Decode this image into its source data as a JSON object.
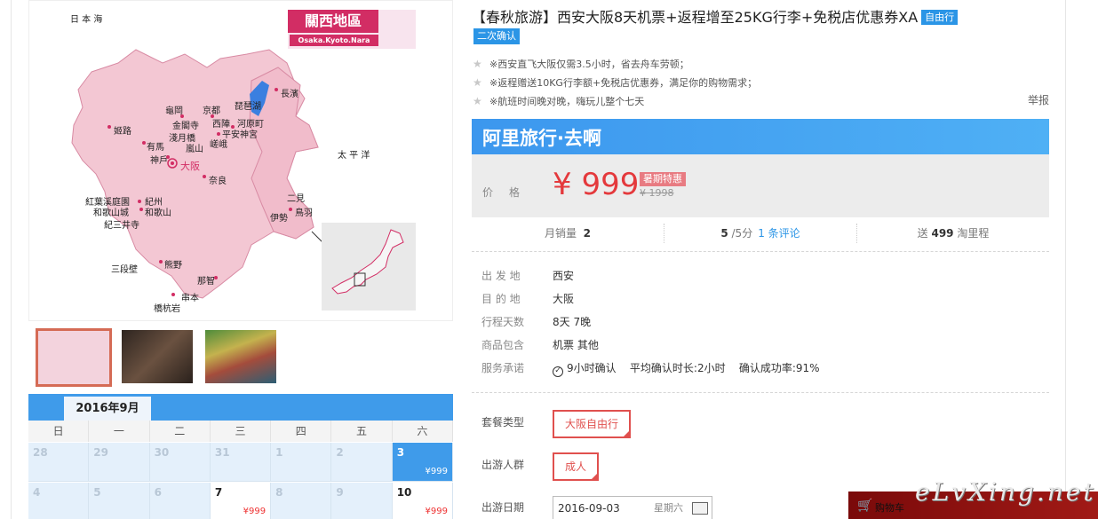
{
  "map": {
    "badge_title": "關西地區",
    "badge_sub": "Osaka.Kyoto.Nara",
    "sea_japan": "日   本   海",
    "sea_pacific": "太   平   洋",
    "places": {
      "nagahama": "長濱",
      "biwa": "琵琶湖",
      "kameoka": "龜岡",
      "kinkakuji": "金閣寺",
      "arashiyama_temple": "淺月橋",
      "kyoto": "京都",
      "nishijin": "西陣",
      "kawaramachi": "河原町",
      "heian": "平安神宮",
      "arashiyama": "嵐山",
      "saga": "嵯峨",
      "himeji": "姬路",
      "arima": "有馬",
      "kobe": "神戶",
      "osaka": "大阪",
      "nara": "奈良",
      "kishu": "紅葉溪庭園",
      "wakayama_castle": "和歌山城",
      "kimiidera": "紀三井寺",
      "kishu2": "紀州",
      "wakayama": "和歌山",
      "futami": "二見",
      "ise": "伊勢",
      "toba": "鳥羽",
      "sandanbeki": "三段壁",
      "kumano": "熊野",
      "nachi": "那智",
      "kushimoto": "串本",
      "shionomisaki": "橋杭岩"
    }
  },
  "calendar": {
    "month": "2016年9月",
    "weekdays": [
      "日",
      "一",
      "二",
      "三",
      "四",
      "五",
      "六"
    ],
    "rows": [
      [
        {
          "day": "28",
          "price": ""
        },
        {
          "day": "29",
          "price": ""
        },
        {
          "day": "30",
          "price": ""
        },
        {
          "day": "31",
          "price": ""
        },
        {
          "day": "1",
          "price": ""
        },
        {
          "day": "2",
          "price": ""
        },
        {
          "day": "3",
          "price": "¥999"
        }
      ],
      [
        {
          "day": "4",
          "price": ""
        },
        {
          "day": "5",
          "price": ""
        },
        {
          "day": "6",
          "price": ""
        },
        {
          "day": "7",
          "price": "¥999"
        },
        {
          "day": "8",
          "price": ""
        },
        {
          "day": "9",
          "price": ""
        },
        {
          "day": "10",
          "price": "¥999"
        }
      ]
    ]
  },
  "product": {
    "title": "【春秋旅游】西安大阪8天机票+返程增至25KG行李+免税店优惠券XA",
    "tag_free": "自由行",
    "tag_confirm": "二次确认",
    "highlights": [
      "※西安直飞大阪仅需3.5小时，省去舟车劳顿；",
      "※返程赠送10KG行李额+免税店优惠券，满足你的购物需求；",
      "※航班时间晚对晚，嗨玩儿整个七天"
    ],
    "report": "举报",
    "brand": "阿里旅行·去啊",
    "price_label": "价格",
    "price": "¥ 999",
    "sale_badge": "暑期特惠",
    "old_price": "¥ 1998"
  },
  "stats": {
    "monthly_label": "月销量",
    "monthly_value": "2",
    "rating_value": "5",
    "rating_suffix": "/5分",
    "reviews_link": "1 条评论",
    "points_prefix": "送",
    "points_value": "499",
    "points_suffix": "淘里程"
  },
  "info": [
    {
      "label": "出 发 地",
      "value": "西安"
    },
    {
      "label": "目 的 地",
      "value": "大阪"
    },
    {
      "label": "行程天数",
      "value": "8天 7晚"
    },
    {
      "label": "商品包含",
      "value": "机票   其他"
    }
  ],
  "service": {
    "label": "服务承诺",
    "confirm": "9小时确认",
    "avg": "平均确认时长:2小时",
    "rate": "确认成功率:91%"
  },
  "options": {
    "package_label": "套餐类型",
    "package_value": "大阪自由行",
    "people_label": "出游人群",
    "people_value": "成人",
    "date_label": "出游日期",
    "date_value": "2016-09-03",
    "date_weekday": "星期六"
  },
  "cart": {
    "label": "购物车"
  },
  "watermark": "eLvXing.net",
  "colors": {
    "accent_blue": "#3f9bea",
    "price_red": "#e4393c",
    "option_red": "#e0504e",
    "map_pink": "#f3c7d3"
  }
}
